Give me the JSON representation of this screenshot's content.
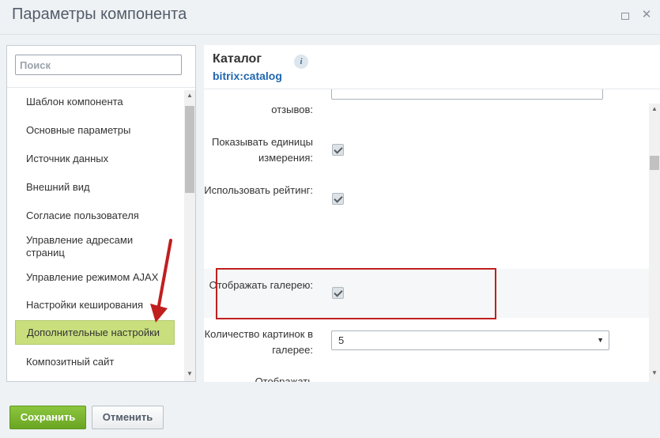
{
  "window": {
    "title": "Параметры компонента",
    "maximize_icon": "maximize-icon",
    "close_icon": "close-icon",
    "close_glyph": "✕"
  },
  "sidebar": {
    "search_placeholder": "Поиск",
    "items": [
      {
        "label": "Шаблон компонента"
      },
      {
        "label": "Основные параметры"
      },
      {
        "label": "Источник данных"
      },
      {
        "label": "Внешний вид"
      },
      {
        "label": "Согласие пользователя"
      },
      {
        "label": "Управление адресами страниц"
      },
      {
        "label": "Управление режимом AJAX"
      },
      {
        "label": "Настройки кеширования"
      },
      {
        "label": "Дополнительные настройки",
        "active": true
      },
      {
        "label": "Композитный сайт"
      }
    ]
  },
  "content": {
    "title": "Каталог",
    "code": "bitrix:catalog",
    "info_glyph": "i",
    "options": [
      {
        "label": "отзывов:",
        "type": "input"
      },
      {
        "label": "Показывать единицы измерения:",
        "type": "checkbox",
        "checked": true
      },
      {
        "label": "Использовать рейтинг:",
        "type": "checkbox",
        "checked": true
      },
      {
        "label": "Отображать галерею:",
        "type": "checkbox",
        "checked": true,
        "highlighted": true
      },
      {
        "label": "Количество картинок в галерее:",
        "type": "select",
        "value": "5"
      },
      {
        "label": "Отображать недоступные значения свойств",
        "type": "checkbox",
        "checked": true
      }
    ]
  },
  "footer": {
    "save_label": "Сохранить",
    "cancel_label": "Отменить"
  },
  "colors": {
    "active_item": "#c9df7e",
    "save_button": "#6aa523",
    "highlight_border": "#c01f1f",
    "link_code": "#2067b0"
  }
}
